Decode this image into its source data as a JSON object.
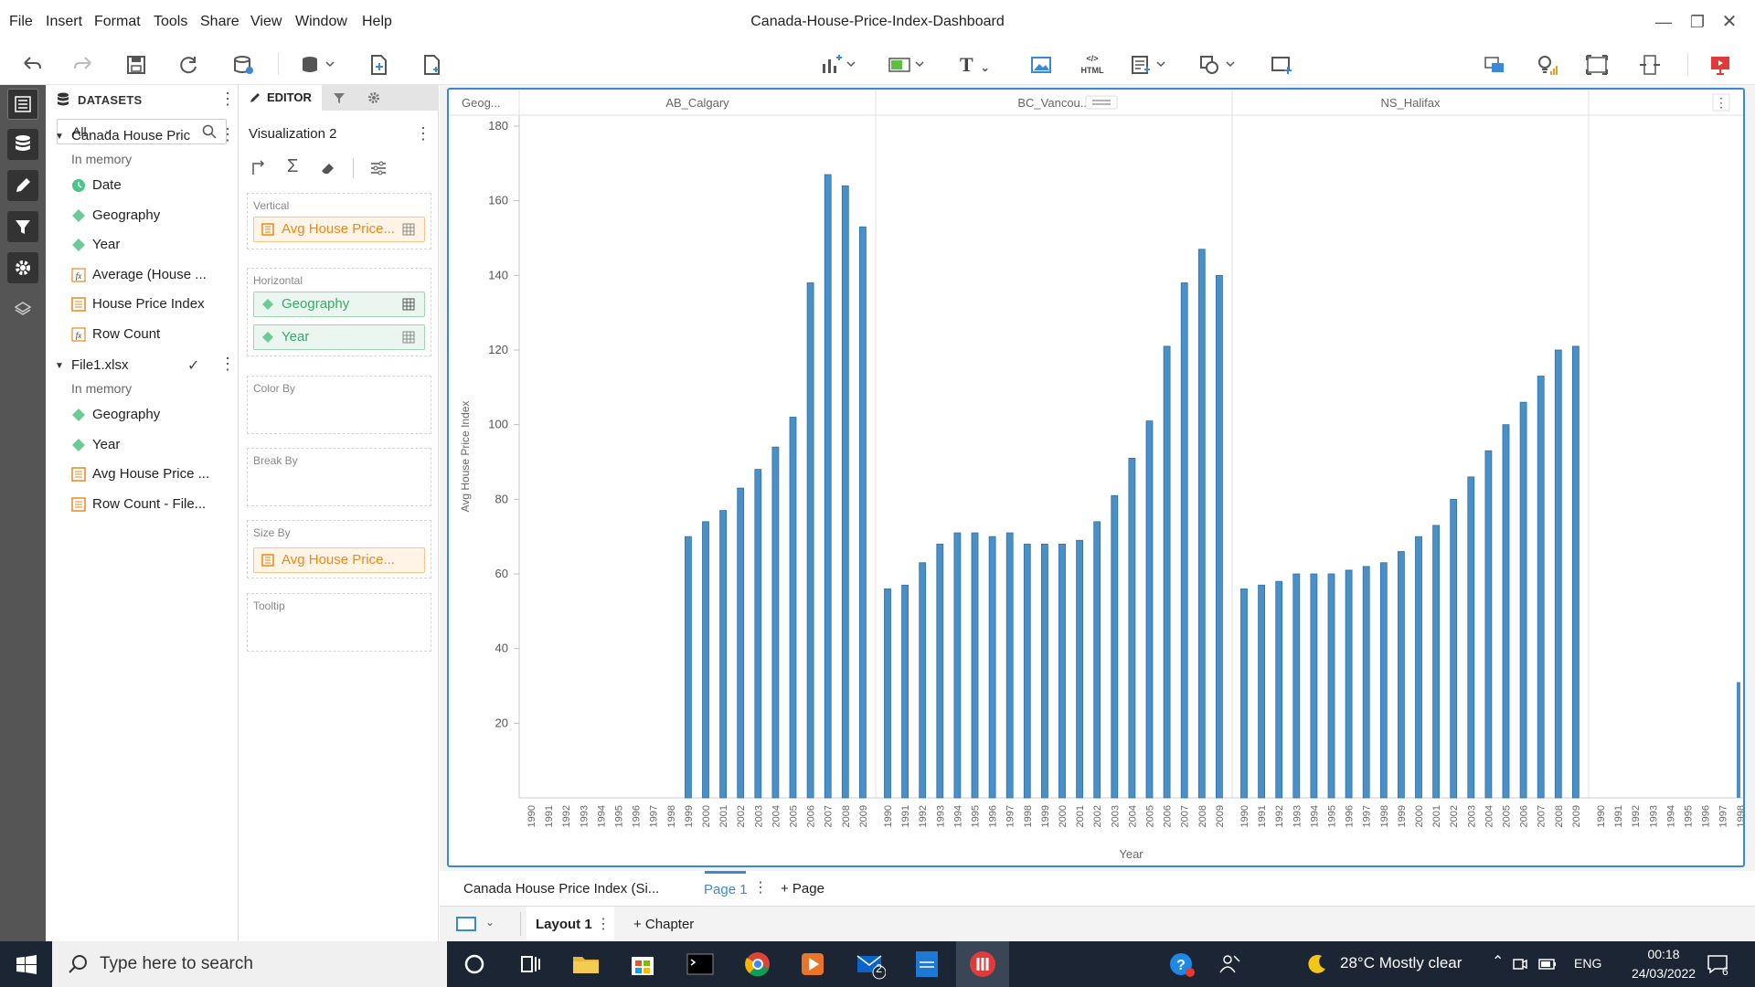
{
  "window": {
    "title": "Canada-House-Price-Index-Dashboard"
  },
  "menu": [
    "File",
    "Insert",
    "Format",
    "Tools",
    "Share",
    "View",
    "Window",
    "Help"
  ],
  "datasets": {
    "header": "DATASETS",
    "filter": "All",
    "items": [
      {
        "label": "Canada House Price...",
        "sub": "In memory",
        "fields": [
          {
            "icon": "clock-icon",
            "label": "Date"
          },
          {
            "icon": "diamond-icon",
            "label": "Geography"
          },
          {
            "icon": "diamond-icon",
            "label": "Year"
          },
          {
            "icon": "fx-icon",
            "label": "Average (House ..."
          },
          {
            "icon": "measure-icon",
            "label": "House Price Index"
          },
          {
            "icon": "fx-icon",
            "label": "Row Count"
          }
        ]
      },
      {
        "label": "File1.xlsx",
        "sub": "In memory",
        "fields": [
          {
            "icon": "diamond-icon",
            "label": "Geography"
          },
          {
            "icon": "diamond-icon",
            "label": "Year"
          },
          {
            "icon": "measure-icon",
            "label": "Avg House Price ..."
          },
          {
            "icon": "measure-icon",
            "label": "Row Count - File..."
          }
        ]
      }
    ]
  },
  "editor": {
    "tab": "EDITOR",
    "viz_name": "Visualization 2",
    "shelves": {
      "vertical": {
        "label": "Vertical",
        "pill": "Avg House Price..."
      },
      "horizontal": {
        "label": "Horizontal",
        "pills": [
          "Geography",
          "Year"
        ]
      },
      "color": {
        "label": "Color By"
      },
      "break": {
        "label": "Break By"
      },
      "size": {
        "label": "Size By",
        "pill": "Avg House Price..."
      },
      "tooltip": {
        "label": "Tooltip"
      }
    }
  },
  "pages": {
    "dataset_tab": "Canada House Price Index (Si...",
    "active": "Page 1",
    "add": "+ Page",
    "layout": "Layout 1",
    "chapter": "+ Chapter"
  },
  "taskbar": {
    "search_placeholder": "Type here to search",
    "weather": "28°C  Mostly clear",
    "lang": "ENG",
    "time": "00:18",
    "date": "24/03/2022",
    "mail_badge": "2",
    "notif": "6"
  },
  "colors": {
    "bar": "#4a90c8",
    "accent": "#3a88d8"
  },
  "chart_data": {
    "type": "bar",
    "header_first": "Geog...",
    "panels": [
      "AB_Calgary",
      "BC_Vancou...",
      "NS_Halifax",
      ""
    ],
    "ylabel": "Avg House Price Index",
    "xlabel": "Year",
    "ylim": [
      0,
      180
    ],
    "yticks": [
      20,
      40,
      60,
      80,
      100,
      120,
      140,
      160,
      180
    ],
    "years": [
      "1990",
      "1991",
      "1992",
      "1993",
      "1994",
      "1995",
      "1996",
      "1997",
      "1998",
      "1999",
      "2000",
      "2001",
      "2002",
      "2003",
      "2004",
      "2005",
      "2006",
      "2007",
      "2008",
      "2009"
    ],
    "last_years": [
      "1990",
      "1991",
      "1992",
      "1993",
      "1994",
      "1995",
      "1996",
      "1997",
      "1998"
    ],
    "series": [
      {
        "name": "AB_Calgary",
        "values": [
          null,
          null,
          null,
          null,
          null,
          null,
          null,
          null,
          null,
          70,
          74,
          77,
          83,
          88,
          94,
          102,
          138,
          167,
          164,
          153
        ]
      },
      {
        "name": "BC_Vancou...",
        "values": [
          56,
          57,
          63,
          68,
          71,
          71,
          70,
          71,
          68,
          68,
          68,
          69,
          74,
          81,
          91,
          101,
          121,
          138,
          147,
          140
        ]
      },
      {
        "name": "NS_Halifax",
        "values": [
          56,
          57,
          58,
          60,
          60,
          60,
          61,
          62,
          63,
          66,
          70,
          73,
          80,
          86,
          93,
          100,
          106,
          113,
          120,
          121
        ]
      }
    ]
  }
}
